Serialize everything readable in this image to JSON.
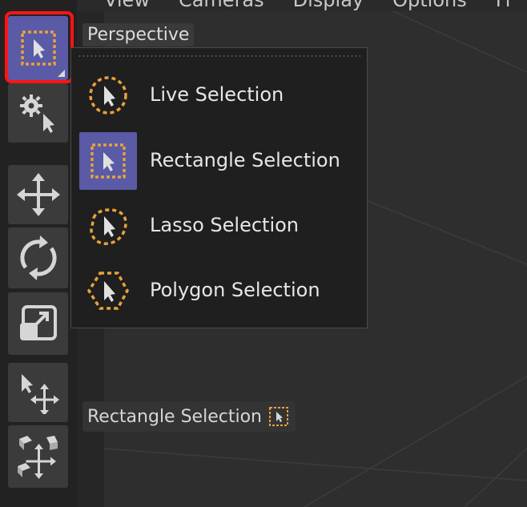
{
  "menubar": {
    "items": [
      "View",
      "Cameras",
      "Display",
      "Options",
      "Fi"
    ]
  },
  "viewport": {
    "label": "Perspective"
  },
  "dropdown": {
    "items": [
      {
        "label": "Live Selection",
        "icon": "live-selection-icon",
        "selected": false
      },
      {
        "label": "Rectangle Selection",
        "icon": "rectangle-selection-icon",
        "selected": true
      },
      {
        "label": "Lasso Selection",
        "icon": "lasso-selection-icon",
        "selected": false
      },
      {
        "label": "Polygon Selection",
        "icon": "polygon-selection-icon",
        "selected": false
      }
    ]
  },
  "toolbar": {
    "tools": [
      {
        "icon": "rectangle-selection-icon",
        "active": true
      },
      {
        "icon": "gear-cursor-icon",
        "active": false
      },
      {
        "icon": "move-icon",
        "active": false
      },
      {
        "icon": "rotate-icon",
        "active": false
      },
      {
        "icon": "scale-icon",
        "active": false
      },
      {
        "icon": "cursor-move-icon",
        "active": false
      },
      {
        "icon": "multi-transform-icon",
        "active": false
      }
    ]
  },
  "status": {
    "tip": "Rectangle Selection"
  },
  "colors": {
    "accent_selected": "#5a5aa6",
    "selection_orange": "#e8a23a",
    "highlight_red": "#ff1414"
  }
}
